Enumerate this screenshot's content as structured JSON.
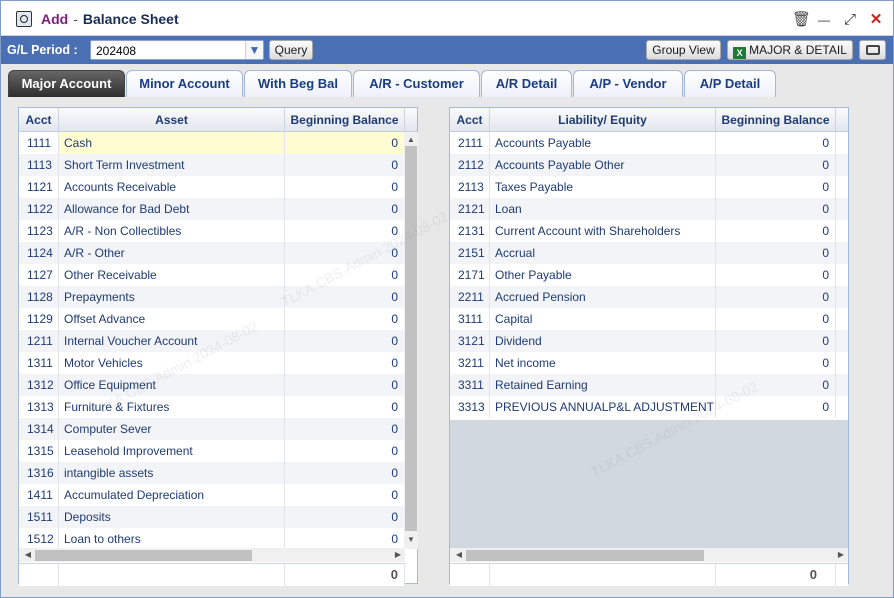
{
  "window": {
    "mode": "Add",
    "separator": "-",
    "title": "Balance Sheet",
    "controls": {
      "delete": "🗑",
      "minimize": "—",
      "maximize": "⤢",
      "close": "✕"
    }
  },
  "toolbar": {
    "period_label": "G/L Period :",
    "period_value": "202408",
    "query_label": "Query",
    "group_view_label": "Group View",
    "major_detail_label": "MAJOR & DETAIL",
    "excel_glyph": "X"
  },
  "tabs": [
    {
      "label": "Major Account",
      "active": true
    },
    {
      "label": "Minor Account"
    },
    {
      "label": "With Beg Bal"
    },
    {
      "label": "A/R - Customer"
    },
    {
      "label": "A/R Detail"
    },
    {
      "label": "A/P - Vendor"
    },
    {
      "label": "A/P Detail"
    }
  ],
  "asset_table": {
    "columns": [
      "Acct",
      "Asset",
      "Beginning Balance"
    ],
    "rows": [
      {
        "acct": "1111",
        "name": "Cash",
        "balance": "0"
      },
      {
        "acct": "1113",
        "name": "Short Term Investment",
        "balance": "0"
      },
      {
        "acct": "1121",
        "name": "Accounts Receivable",
        "balance": "0"
      },
      {
        "acct": "1122",
        "name": "Allowance for Bad Debt",
        "balance": "0"
      },
      {
        "acct": "1123",
        "name": "A/R - Non Collectibles",
        "balance": "0"
      },
      {
        "acct": "1124",
        "name": "A/R - Other",
        "balance": "0"
      },
      {
        "acct": "1127",
        "name": "Other Receivable",
        "balance": "0"
      },
      {
        "acct": "1128",
        "name": "Prepayments",
        "balance": "0"
      },
      {
        "acct": "1129",
        "name": "Offset Advance",
        "balance": "0"
      },
      {
        "acct": "1211",
        "name": "Internal Voucher Account",
        "balance": "0"
      },
      {
        "acct": "1311",
        "name": "Motor Vehicles",
        "balance": "0"
      },
      {
        "acct": "1312",
        "name": "Office Equipment",
        "balance": "0"
      },
      {
        "acct": "1313",
        "name": "Furniture & Fixtures",
        "balance": "0"
      },
      {
        "acct": "1314",
        "name": "Computer Sever",
        "balance": "0"
      },
      {
        "acct": "1315",
        "name": "Leasehold Improvement",
        "balance": "0"
      },
      {
        "acct": "1316",
        "name": "intangible assets",
        "balance": "0"
      },
      {
        "acct": "1411",
        "name": "Accumulated Depreciation",
        "balance": "0"
      },
      {
        "acct": "1511",
        "name": "Deposits",
        "balance": "0"
      },
      {
        "acct": "1512",
        "name": "Loan to others",
        "balance": "0"
      }
    ],
    "total": "0"
  },
  "liability_table": {
    "columns": [
      "Acct",
      "Liability/ Equity",
      "Beginning Balance"
    ],
    "rows": [
      {
        "acct": "2111",
        "name": "Accounts Payable",
        "balance": "0"
      },
      {
        "acct": "2112",
        "name": "Accounts Payable Other",
        "balance": "0"
      },
      {
        "acct": "2113",
        "name": "Taxes Payable",
        "balance": "0"
      },
      {
        "acct": "2121",
        "name": "Loan",
        "balance": "0"
      },
      {
        "acct": "2131",
        "name": "Current Account with Shareholders",
        "balance": "0"
      },
      {
        "acct": "2151",
        "name": "Accrual",
        "balance": "0"
      },
      {
        "acct": "2171",
        "name": "Other Payable",
        "balance": "0"
      },
      {
        "acct": "2211",
        "name": "Accrued Pension",
        "balance": "0"
      },
      {
        "acct": "3111",
        "name": "Capital",
        "balance": "0"
      },
      {
        "acct": "3121",
        "name": "Dividend",
        "balance": "0"
      },
      {
        "acct": "3211",
        "name": "Net income",
        "balance": "0"
      },
      {
        "acct": "3311",
        "name": "Retained Earning",
        "balance": "0"
      },
      {
        "acct": "3313",
        "name": "PREVIOUS ANNUALP&L ADJUSTMENT",
        "balance": "0"
      }
    ],
    "total": "0"
  },
  "watermark": "TLKA.CBS.Admin 2024-08-02"
}
